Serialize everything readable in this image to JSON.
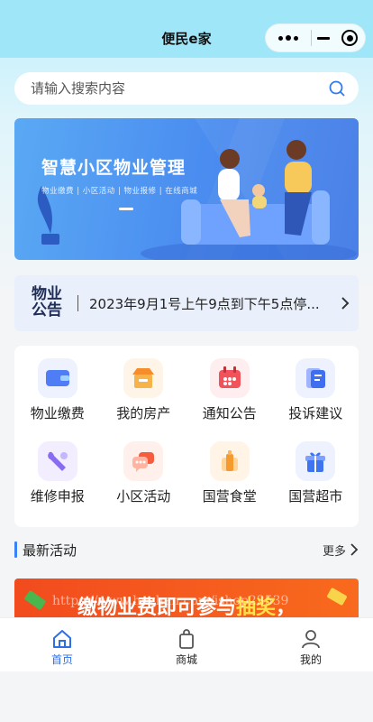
{
  "app": {
    "title": "便民e家"
  },
  "search": {
    "placeholder": "请输入搜索内容"
  },
  "banner": {
    "title": "智慧小区物业管理",
    "subtitle": "物业缴费 | 小区活动 | 物业报修 | 在线商城"
  },
  "notice": {
    "logo_top": "物业",
    "logo_bottom": "公告",
    "text": "2023年9月1号上午9点到下午5点停..."
  },
  "services": [
    {
      "label": "物业缴费",
      "icon": "wallet-icon",
      "color": "#4e7df5"
    },
    {
      "label": "我的房产",
      "icon": "house-icon",
      "color": "#f5a133"
    },
    {
      "label": "通知公告",
      "icon": "calendar-icon",
      "color": "#f2525a"
    },
    {
      "label": "投诉建议",
      "icon": "document-icon",
      "color": "#3f6ef0"
    },
    {
      "label": "维修申报",
      "icon": "wrench-icon",
      "color": "#8a6cf0"
    },
    {
      "label": "小区活动",
      "icon": "chat-icon",
      "color": "#f5664a"
    },
    {
      "label": "国营食堂",
      "icon": "canteen-icon",
      "color": "#f59a2e"
    },
    {
      "label": "国营超市",
      "icon": "gift-icon",
      "color": "#3f74f0"
    }
  ],
  "section": {
    "title": "最新活动",
    "more": "更多"
  },
  "promo": {
    "text_main": "缴物业费即可参与",
    "text_highlight": "抽奖",
    "text_end": "，",
    "watermark": "https://www.huzhan.com/ishop23539"
  },
  "tabs": [
    {
      "label": "首页",
      "icon": "home-icon",
      "active": true
    },
    {
      "label": "商城",
      "icon": "shopping-bag-icon",
      "active": false
    },
    {
      "label": "我的",
      "icon": "user-icon",
      "active": false
    }
  ]
}
